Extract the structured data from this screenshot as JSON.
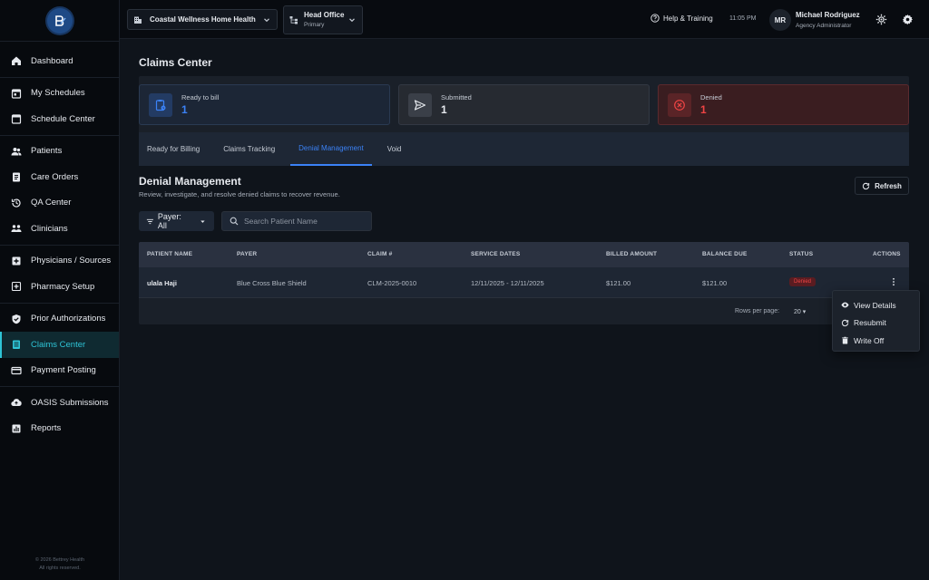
{
  "sidebar": {
    "footer_line1": "© 2026 Bettrey Health",
    "footer_line2": "All rights reserved.",
    "groups": [
      [
        {
          "label": "Dashboard",
          "icon": "home-icon"
        }
      ],
      [
        {
          "label": "My Schedules",
          "icon": "calendar-check-icon"
        },
        {
          "label": "Schedule Center",
          "icon": "calendar-icon"
        }
      ],
      [
        {
          "label": "Patients",
          "icon": "people-icon"
        },
        {
          "label": "Care Orders",
          "icon": "clipboard-icon"
        },
        {
          "label": "QA Center",
          "icon": "history-icon"
        },
        {
          "label": "Clinicians",
          "icon": "group-icon"
        }
      ],
      [
        {
          "label": "Physicians / Sources",
          "icon": "plus-box-icon"
        },
        {
          "label": "Pharmacy Setup",
          "icon": "pharmacy-icon"
        }
      ],
      [
        {
          "label": "Prior Authorizations",
          "icon": "shield-check-icon"
        },
        {
          "label": "Claims Center",
          "icon": "document-icon",
          "active": true
        },
        {
          "label": "Payment Posting",
          "icon": "card-icon"
        }
      ],
      [
        {
          "label": "OASIS Submissions",
          "icon": "cloud-upload-icon"
        },
        {
          "label": "Reports",
          "icon": "bar-chart-icon"
        }
      ]
    ]
  },
  "topbar": {
    "org": "Coastal Wellness Home Health",
    "office_name": "Head Office",
    "office_sub": "Primary",
    "help": "Help & Training",
    "time": "11:05 PM",
    "avatar_initials": "MR",
    "user_name": "Michael Rodriguez",
    "user_role": "Agency Administrator"
  },
  "page": {
    "title": "Claims Center",
    "stats": [
      {
        "label": "Ready to bill",
        "value": "1"
      },
      {
        "label": "Submitted",
        "value": "1"
      },
      {
        "label": "Denied",
        "value": "1"
      }
    ],
    "tabs": [
      "Ready for Billing",
      "Claims Tracking",
      "Denial Management",
      "Void"
    ],
    "active_tab": "Denial Management",
    "section_title": "Denial Management",
    "section_subtitle": "Review, investigate, and resolve denied claims to recover revenue.",
    "refresh_label": "Refresh",
    "payer_filter": "Payer: All",
    "search_placeholder": "Search Patient Name"
  },
  "table": {
    "headers": [
      "PATIENT NAME",
      "PAYER",
      "CLAIM #",
      "SERVICE DATES",
      "BILLED AMOUNT",
      "BALANCE DUE",
      "STATUS",
      "ACTIONS"
    ],
    "rows": [
      {
        "patient": "ulala Haji",
        "payer": "Blue Cross Blue Shield",
        "claim": "CLM-2025-0010",
        "dates": "12/11/2025 - 12/11/2025",
        "billed": "$121.00",
        "balance": "$121.00",
        "status": "Denied"
      }
    ],
    "rows_per_page_label": "Rows per page:",
    "rows_per_page": "20"
  },
  "actions_menu": {
    "items": [
      "View Details",
      "Resubmit",
      "Write Off"
    ]
  },
  "colors": {
    "accent": "#3b82f6",
    "sidebar_active": "#2ec4d6",
    "danger": "#ef4444"
  }
}
